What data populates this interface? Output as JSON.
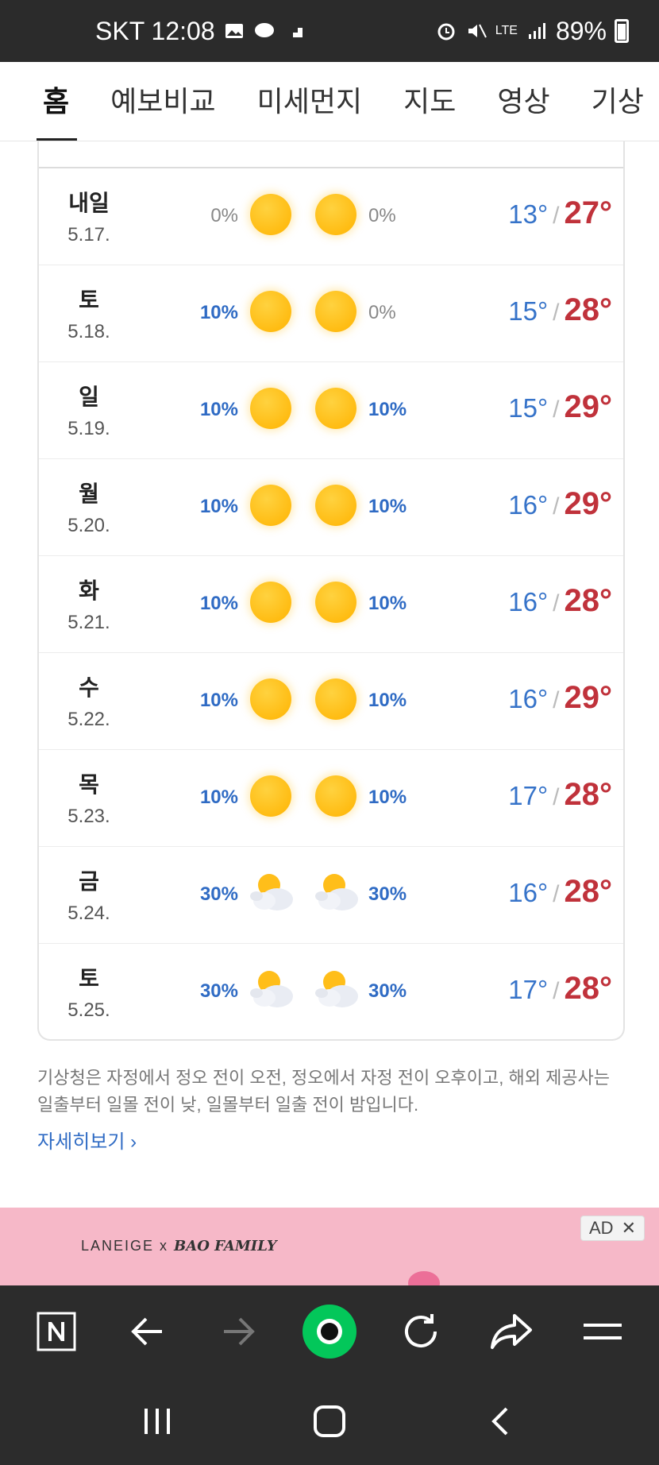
{
  "status_bar": {
    "carrier_time": "SKT 12:08",
    "network": "LTE",
    "battery": "89%"
  },
  "tabs": [
    {
      "label": "홈",
      "active": true
    },
    {
      "label": "예보비교",
      "active": false
    },
    {
      "label": "미세먼지",
      "active": false
    },
    {
      "label": "지도",
      "active": false
    },
    {
      "label": "영상",
      "active": false
    },
    {
      "label": "기상",
      "active": false
    }
  ],
  "forecast": [
    {
      "day": "내일",
      "date": "5.17.",
      "am_pct": "0%",
      "pm_pct": "0%",
      "am_icon": "sun-icon",
      "pm_icon": "sun-icon",
      "low": "13°",
      "high": "27°"
    },
    {
      "day": "토",
      "date": "5.18.",
      "am_pct": "10%",
      "pm_pct": "0%",
      "am_icon": "sun-icon",
      "pm_icon": "sun-icon",
      "low": "15°",
      "high": "28°"
    },
    {
      "day": "일",
      "date": "5.19.",
      "am_pct": "10%",
      "pm_pct": "10%",
      "am_icon": "sun-icon",
      "pm_icon": "sun-icon",
      "low": "15°",
      "high": "29°"
    },
    {
      "day": "월",
      "date": "5.20.",
      "am_pct": "10%",
      "pm_pct": "10%",
      "am_icon": "sun-icon",
      "pm_icon": "sun-icon",
      "low": "16°",
      "high": "29°"
    },
    {
      "day": "화",
      "date": "5.21.",
      "am_pct": "10%",
      "pm_pct": "10%",
      "am_icon": "sun-icon",
      "pm_icon": "sun-icon",
      "low": "16°",
      "high": "28°"
    },
    {
      "day": "수",
      "date": "5.22.",
      "am_pct": "10%",
      "pm_pct": "10%",
      "am_icon": "sun-icon",
      "pm_icon": "sun-icon",
      "low": "16°",
      "high": "29°"
    },
    {
      "day": "목",
      "date": "5.23.",
      "am_pct": "10%",
      "pm_pct": "10%",
      "am_icon": "sun-icon",
      "pm_icon": "sun-icon",
      "low": "17°",
      "high": "28°"
    },
    {
      "day": "금",
      "date": "5.24.",
      "am_pct": "30%",
      "pm_pct": "30%",
      "am_icon": "partly-cloudy-icon",
      "pm_icon": "partly-cloudy-icon",
      "low": "16°",
      "high": "28°"
    },
    {
      "day": "토",
      "date": "5.25.",
      "am_pct": "30%",
      "pm_pct": "30%",
      "am_icon": "partly-cloudy-icon",
      "pm_icon": "partly-cloudy-icon",
      "low": "17°",
      "high": "28°"
    }
  ],
  "temp_separator": "/",
  "note": "기상청은 자정에서 정오 전이 오전, 정오에서 자정 전이 오후이고, 해외 제공사는 일출부터 일몰 전이 낮, 일몰부터 일출 전이 밤입니다.",
  "more_link": "자세히보기",
  "ad": {
    "brand": "LANEIGE x",
    "brand2": "BAO FAMILY",
    "badge": "AD",
    "close": "✕"
  },
  "colors": {
    "rain_pct": "#2f6bc4",
    "temp_low": "#3673c9",
    "temp_high": "#c0323b",
    "accent_green": "#03c75a"
  }
}
